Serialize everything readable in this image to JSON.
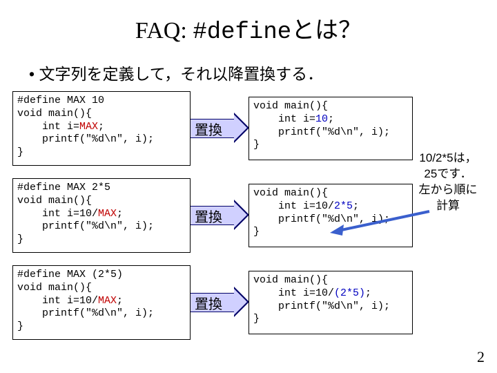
{
  "title_prefix": "FAQ: ",
  "title_code": "#define",
  "title_suffix": "とは？",
  "bullet": "• 文字列を定義して，それ以降置換する．",
  "arrow_label": "置換",
  "examples": [
    {
      "left_pre": "#define MAX 10\nvoid main(){\n    int i=",
      "left_max": "MAX",
      "left_post": ";\n    printf(\"%d\\n\", i);\n}",
      "right_pre": "void main(){\n    int i=",
      "right_repl": "10",
      "right_post": ";\n    printf(\"%d\\n\", i);\n}"
    },
    {
      "left_pre": "#define MAX 2*5\nvoid main(){\n    int i=10/",
      "left_max": "MAX",
      "left_post": ";\n    printf(\"%d\\n\", i);\n}",
      "right_pre": "void main(){\n    int i=10/",
      "right_repl": "2*5",
      "right_post": ";\n    printf(\"%d\\n\", i);\n}"
    },
    {
      "left_pre": "#define MAX (2*5)\nvoid main(){\n    int i=10/",
      "left_max": "MAX",
      "left_post": ";\n    printf(\"%d\\n\", i);\n}",
      "right_pre": "void main(){\n    int i=10/",
      "right_repl": "(2*5)",
      "right_post": ";\n    printf(\"%d\\n\", i);\n}"
    }
  ],
  "note_line1": "10/2*5は，",
  "note_line2": "25です．",
  "note_line3": "左から順に",
  "note_line4": "計算",
  "page_number": "2"
}
